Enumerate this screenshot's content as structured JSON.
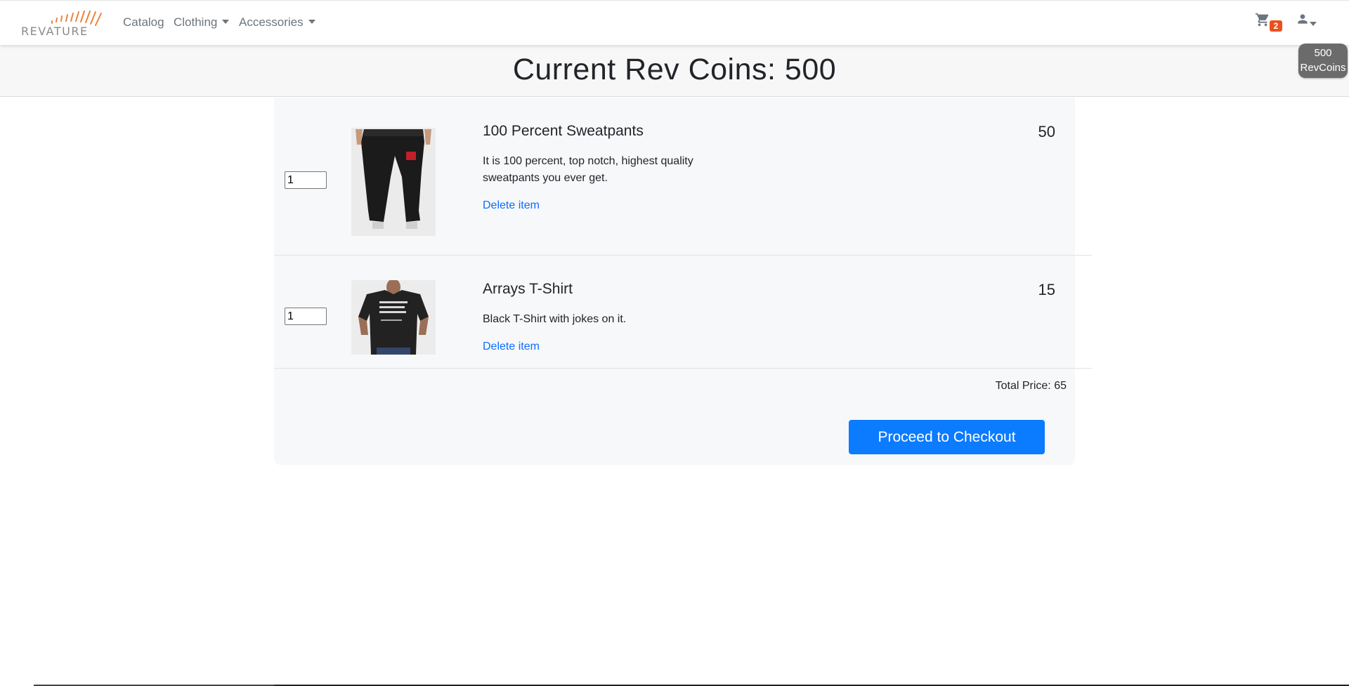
{
  "navbar": {
    "logo_text": "REVATURE",
    "links": [
      {
        "label": "Catalog"
      },
      {
        "label": "Clothing"
      },
      {
        "label": "Accessories"
      }
    ],
    "cart_count": "2",
    "coins_badge": {
      "amount": "500",
      "unit": "RevCoins"
    }
  },
  "header": {
    "title": "Current Rev Coins: 500"
  },
  "cart": {
    "items": [
      {
        "quantity": "1",
        "name": "100 Percent Sweatpants",
        "description": "It is 100 percent, top notch, highest quality sweatpants you ever get.",
        "delete_label": "Delete item",
        "price": "50"
      },
      {
        "quantity": "1",
        "name": "Arrays T-Shirt",
        "description": "Black T-Shirt with jokes on it.",
        "delete_label": "Delete item",
        "price": "15"
      }
    ],
    "total_label": "Total Price: 65",
    "checkout_label": "Proceed to Checkout"
  },
  "colors": {
    "accent": "#0b7bff",
    "badge": "#e9501e",
    "logo_orange": "#f0803c",
    "panel_bg": "#f7f8fa"
  },
  "icons": {
    "cart": "shopping-cart-icon",
    "user": "user-icon"
  }
}
